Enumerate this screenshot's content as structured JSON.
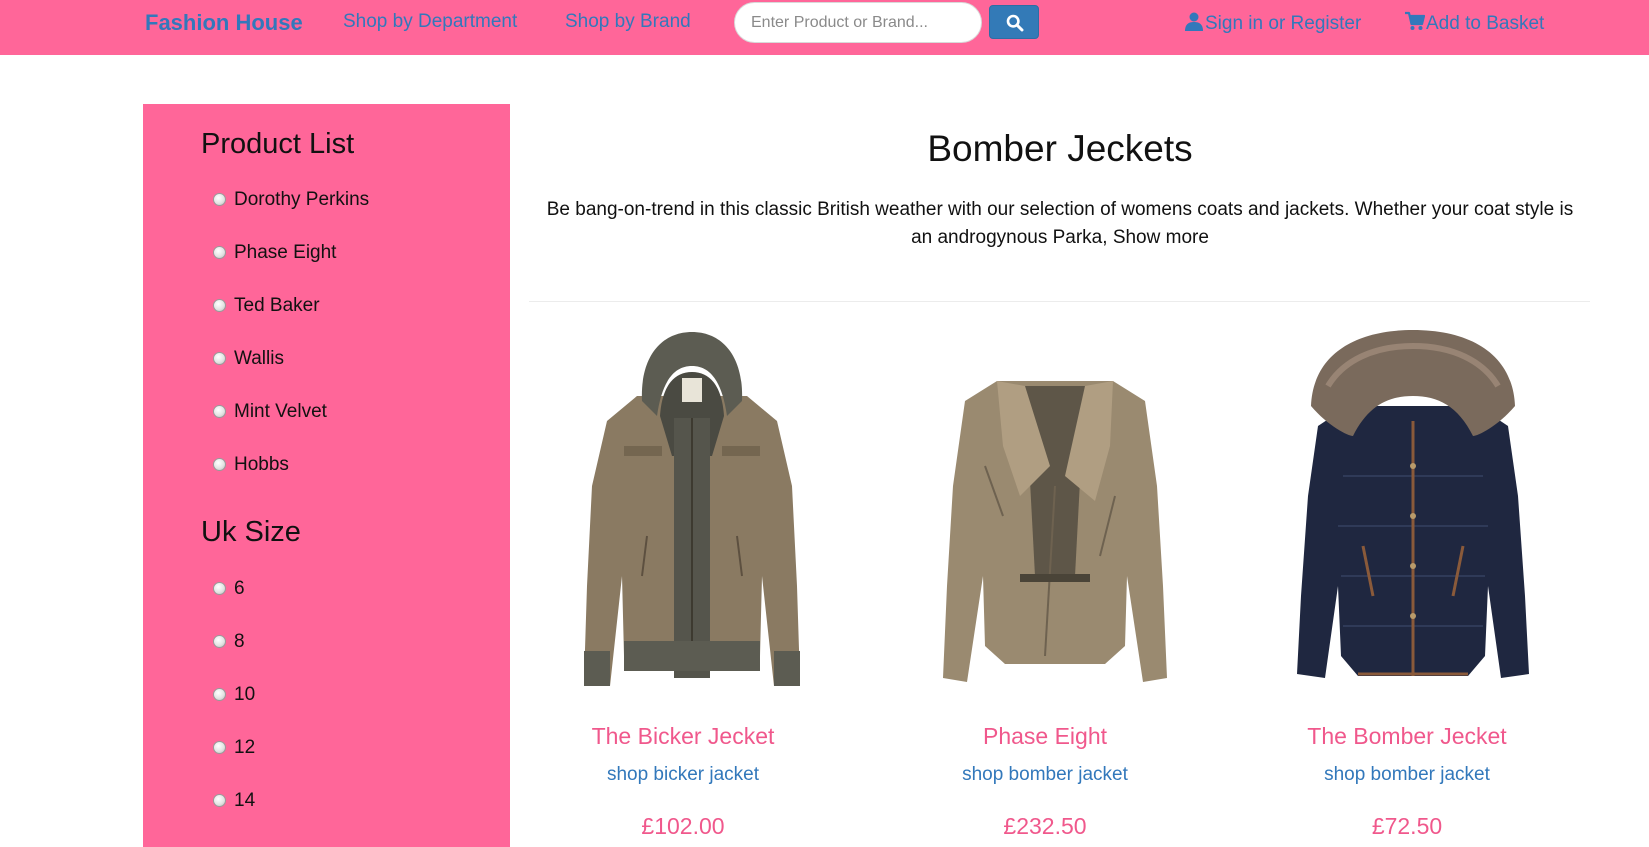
{
  "nav": {
    "brand": "Fashion House",
    "links": [
      "Shop by Department",
      "Shop by Brand"
    ],
    "search_placeholder": "Enter Product or Brand...",
    "sign_in": "Sign in or Register",
    "basket": "Add to Basket"
  },
  "sidebar": {
    "product_list_title": "Product List",
    "products": [
      "Dorothy Perkins",
      "Phase Eight",
      "Ted Baker",
      "Wallis",
      "Mint Velvet",
      "Hobbs"
    ],
    "size_title": "Uk Size",
    "sizes": [
      "6",
      "8",
      "10",
      "12",
      "14"
    ]
  },
  "main": {
    "title": "Bomber Jeckets",
    "description": "Be bang-on-trend in this classic British weather with our selection of womens coats and jackets. Whether your coat style is an androgynous Parka,",
    "show_more": "Show more",
    "products": [
      {
        "name": "The Bicker Jecket",
        "link": "shop bicker jacket",
        "price": "£102.00"
      },
      {
        "name": "Phase Eight",
        "link": "shop bomber jacket",
        "price": "£232.50"
      },
      {
        "name": "The Bomber Jecket",
        "link": "shop bomber jacket",
        "price": "£72.50"
      }
    ]
  },
  "colors": {
    "nav_bg": "#ff6699",
    "link_blue": "#3278bb",
    "accent_pink": "#f0588c",
    "search_button": "#337ab7"
  }
}
